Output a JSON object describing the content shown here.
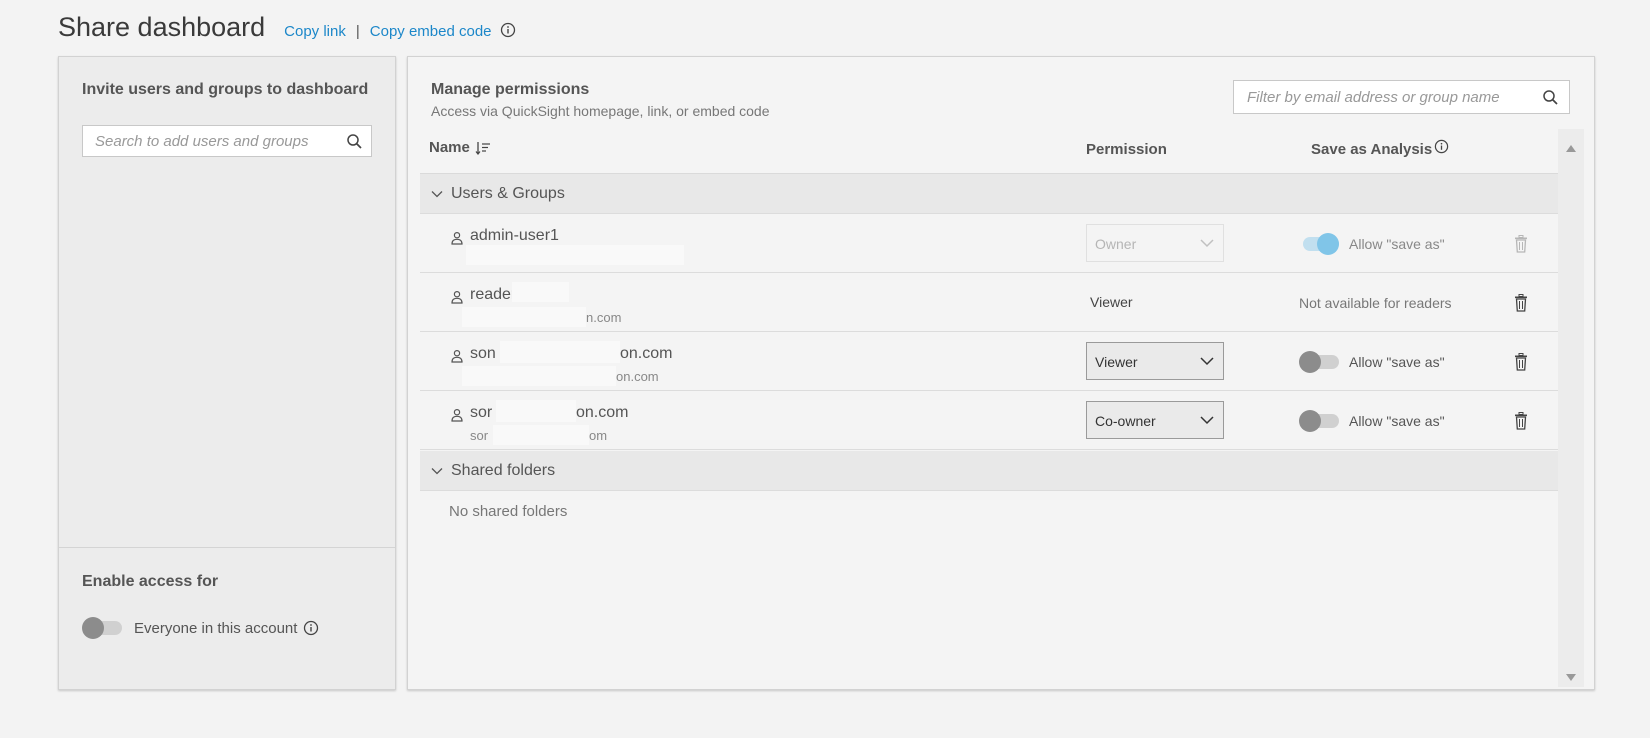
{
  "header": {
    "title": "Share dashboard",
    "copy_link": "Copy link",
    "separator": "|",
    "copy_embed": "Copy embed code"
  },
  "invite": {
    "title": "Invite users and groups to dashboard",
    "search_placeholder": "Search to add users and groups"
  },
  "access": {
    "title": "Enable access for",
    "everyone_label": "Everyone in this account",
    "everyone_enabled": false
  },
  "manage": {
    "title": "Manage permissions",
    "subtitle": "Access via QuickSight homepage, link, or embed code",
    "filter_placeholder": "Filter by email address or group name"
  },
  "columns": {
    "name": "Name",
    "permission": "Permission",
    "save_as": "Save as Analysis"
  },
  "groups": {
    "users_label": "Users & Groups",
    "folders_label": "Shared folders",
    "no_folders": "No shared folders"
  },
  "users": [
    {
      "name": "admin-user1",
      "email": "",
      "permission": "Owner",
      "save_label": "Allow \"save as\"",
      "save_enabled": true
    },
    {
      "name": "reader",
      "email": "n.com",
      "permission": "Viewer",
      "save_label": "Not available for readers"
    },
    {
      "name": "son",
      "name_end": "on.com",
      "email": "on.com",
      "permission": "Viewer",
      "save_label": "Allow \"save as\"",
      "save_enabled": false
    },
    {
      "name": "sor",
      "name_end": "on.com",
      "email": "sor",
      "email_end": "om",
      "permission": "Co-owner",
      "save_label": "Allow \"save as\"",
      "save_enabled": false
    }
  ],
  "colors": {
    "link": "#1c87c9",
    "toggle_on": "#6cbde7",
    "toggle_off": "#8c8c8c"
  },
  "icons": [
    "info-icon",
    "search-icon",
    "sort-icon",
    "chevron-down-icon",
    "user-icon",
    "trash-icon",
    "scroll-up-icon",
    "scroll-down-icon"
  ]
}
